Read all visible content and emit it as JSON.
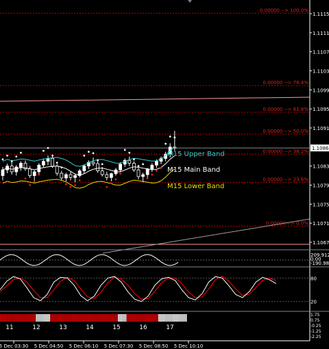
{
  "colors": {
    "background": "#000000",
    "candle_up": "#ffffff",
    "candle_down": "#000000",
    "fib": "#c00000",
    "fib_text": "#e02020",
    "upper_band": "#33cccc",
    "main_band": "#ffffff",
    "lower_band": "#e8e000",
    "dots_up": "#ffffff",
    "dots_down": "#e02020",
    "trendline": "#a0a0a0",
    "pink_line": "#ff9999",
    "stoch_main": "#ffffff",
    "stoch_signal": "#e00000",
    "histo_up": "#ffffff",
    "histo_down": "#e00000",
    "axis_text": "#ffffff",
    "current_price_bg": "#ffffff"
  },
  "fib_levels": [
    {
      "label": "0.00000 --> 100.0%",
      "price": 1.11151
    },
    {
      "label": "0.00000 --> 76.4%",
      "price": 1.10999
    },
    {
      "label": "0.00000 --> 61.8%",
      "price": 1.10943
    },
    {
      "label": "0.00000 --> 50.0%",
      "price": 1.10897
    },
    {
      "label": "0.00000 --> 38.2%",
      "price": 1.10855
    },
    {
      "label": "0.00000 --> 23.6%",
      "price": 1.10796
    },
    {
      "label": "0.00000 --> 0.0%",
      "price": 1.10704
    }
  ],
  "price_axis": {
    "labels": [
      "1.11150",
      "1.11110",
      "1.11070",
      "1.11030",
      "1.10990",
      "1.10950",
      "1.10910",
      "1.10830",
      "1.10790",
      "1.10750",
      "1.10710",
      "1.10670"
    ],
    "current_price": "1.10868"
  },
  "band_labels": {
    "upper": "M15 Upper Band",
    "main": "M15 Main Band",
    "lower": "M15 Lower Band"
  },
  "cci_panel": {
    "labels": [
      "209.912",
      "0.00",
      "-190.984"
    ]
  },
  "stoch_panel": {
    "labels": [
      "80",
      "20"
    ]
  },
  "strip_panel": {
    "labels": [
      "1.75",
      "0.75",
      "-0.25",
      "-1.25",
      "-2.25"
    ]
  },
  "day_labels": [
    "11",
    "12",
    "13",
    "14",
    "15",
    "16",
    "17"
  ],
  "time_labels": [
    "5 Dec 03:30",
    "5 Dec 04:50",
    "5 Dec 06:10",
    "5 Dec 07:30",
    "5 Dec 08:50",
    "5 Dec 10:10"
  ],
  "stoch_series": {
    "main": [
      50,
      72,
      84,
      78,
      55,
      30,
      22,
      38,
      70,
      82,
      80,
      62,
      35,
      22,
      34,
      62,
      80,
      84,
      70,
      45,
      26,
      20,
      34,
      62,
      78,
      82,
      74,
      50,
      30,
      24,
      40,
      70,
      84,
      80,
      60,
      38,
      30,
      45,
      70,
      82,
      76,
      66
    ],
    "signal": [
      45,
      60,
      76,
      80,
      70,
      48,
      30,
      30,
      50,
      72,
      82,
      74,
      52,
      32,
      28,
      44,
      68,
      82,
      78,
      62,
      40,
      26,
      28,
      46,
      68,
      80,
      80,
      66,
      44,
      30,
      32,
      52,
      76,
      84,
      72,
      52,
      36,
      38,
      56,
      74,
      80,
      74
    ]
  },
  "strip_pattern": [
    "r",
    "r",
    "r",
    "r",
    "r",
    "r",
    "r",
    "r",
    "r",
    "r",
    "r",
    "r",
    "r",
    "r",
    "r",
    "r",
    "r",
    "r",
    "r",
    "r",
    "r",
    "r",
    "r",
    "r",
    "r",
    "w",
    "w",
    "w",
    "w",
    "w",
    "w",
    "w",
    "w",
    "w",
    "w",
    "r",
    "r",
    "r",
    "r",
    "r",
    "r",
    "r",
    "r",
    "r",
    "r",
    "r",
    "r",
    "r",
    "r",
    "r",
    "r",
    "r",
    "r",
    "r",
    "r",
    "r",
    "r",
    "r",
    "r",
    "r",
    "r",
    "r",
    "r",
    "r",
    "r",
    "r",
    "r",
    "r",
    "r",
    "r",
    "r",
    "r",
    "r",
    "r",
    "r",
    "r",
    "r",
    "r",
    "r",
    "r",
    "r",
    "r",
    "w",
    "w",
    "w",
    "w",
    "w",
    "w",
    "r",
    "r",
    "r",
    "r",
    "r",
    "r",
    "r",
    "r",
    "r",
    "r",
    "r",
    "r",
    "r",
    "r",
    "r",
    "r",
    "r",
    "r",
    "r",
    "r",
    "r",
    "r",
    "w",
    "w",
    "w",
    "w",
    "w",
    "w",
    "w",
    "w",
    "w",
    "w",
    "w",
    "w",
    "w",
    "w",
    "w",
    "w",
    "w",
    "w",
    "w",
    "w"
  ],
  "candles": [
    [
      1.1081,
      1.10828,
      1.108,
      1.10822
    ],
    [
      1.10822,
      1.10835,
      1.10815,
      1.1083
    ],
    [
      1.1083,
      1.10838,
      1.10812,
      1.10818
    ],
    [
      1.10818,
      1.10832,
      1.1081,
      1.10828
    ],
    [
      1.10828,
      1.1084,
      1.1082,
      1.10836
    ],
    [
      1.10836,
      1.10842,
      1.1082,
      1.10824
    ],
    [
      1.10824,
      1.1083,
      1.10805,
      1.1081
    ],
    [
      1.1081,
      1.10822,
      1.108,
      1.10818
    ],
    [
      1.10818,
      1.10836,
      1.10812,
      1.10832
    ],
    [
      1.10832,
      1.10846,
      1.10826,
      1.1084
    ],
    [
      1.1084,
      1.10852,
      1.10832,
      1.10846
    ],
    [
      1.10846,
      1.1085,
      1.10826,
      1.1083
    ],
    [
      1.1083,
      1.10834,
      1.1081,
      1.10815
    ],
    [
      1.10815,
      1.1082,
      1.108,
      1.10805
    ],
    [
      1.10805,
      1.10816,
      1.10798,
      1.10812
    ],
    [
      1.10812,
      1.10818,
      1.108,
      1.10806
    ],
    [
      1.10806,
      1.10814,
      1.10796,
      1.1081
    ],
    [
      1.1081,
      1.10824,
      1.10806,
      1.1082
    ],
    [
      1.1082,
      1.10834,
      1.10815,
      1.1083
    ],
    [
      1.1083,
      1.10842,
      1.10824,
      1.10838
    ],
    [
      1.10838,
      1.10848,
      1.1083,
      1.10835
    ],
    [
      1.10835,
      1.1084,
      1.10816,
      1.1082
    ],
    [
      1.1082,
      1.10828,
      1.10808,
      1.10812
    ],
    [
      1.10812,
      1.10818,
      1.108,
      1.10806
    ],
    [
      1.10806,
      1.10816,
      1.10798,
      1.10814
    ],
    [
      1.10814,
      1.10826,
      1.1081,
      1.10822
    ],
    [
      1.10822,
      1.10838,
      1.10818,
      1.10834
    ],
    [
      1.10834,
      1.10846,
      1.10828,
      1.10842
    ],
    [
      1.10842,
      1.1085,
      1.1083,
      1.10836
    ],
    [
      1.10836,
      1.1084,
      1.10818,
      1.10822
    ],
    [
      1.10822,
      1.10826,
      1.10802,
      1.10808
    ],
    [
      1.10808,
      1.10816,
      1.10796,
      1.10812
    ],
    [
      1.10812,
      1.10826,
      1.10806,
      1.10824
    ],
    [
      1.10824,
      1.10836,
      1.10818,
      1.10832
    ],
    [
      1.10832,
      1.10844,
      1.10826,
      1.1084
    ],
    [
      1.1084,
      1.1085,
      1.10834,
      1.10846
    ],
    [
      1.10846,
      1.1086,
      1.1084,
      1.10855
    ],
    [
      1.10855,
      1.10878,
      1.10848,
      1.1087
    ],
    [
      1.1087,
      1.10904,
      1.10862,
      1.10868
    ]
  ]
}
